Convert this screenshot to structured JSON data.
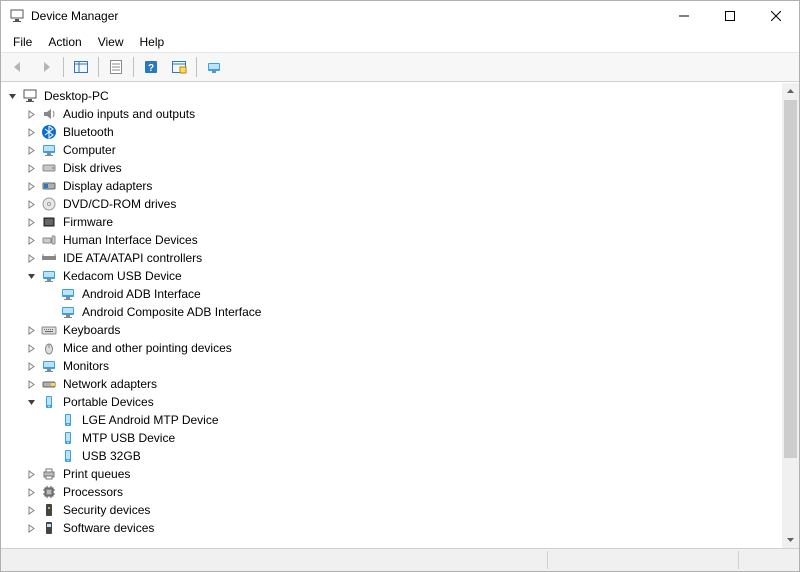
{
  "window": {
    "title": "Device Manager"
  },
  "menu": {
    "file": "File",
    "action": "Action",
    "view": "View",
    "help": "Help"
  },
  "tree": {
    "root": "Desktop-PC",
    "items": [
      {
        "icon": "audio",
        "label": "Audio inputs and outputs",
        "expand": "closed"
      },
      {
        "icon": "bluetooth",
        "label": "Bluetooth",
        "expand": "closed"
      },
      {
        "icon": "computer",
        "label": "Computer",
        "expand": "closed"
      },
      {
        "icon": "disk",
        "label": "Disk drives",
        "expand": "closed"
      },
      {
        "icon": "display",
        "label": "Display adapters",
        "expand": "closed"
      },
      {
        "icon": "dvd",
        "label": "DVD/CD-ROM drives",
        "expand": "closed"
      },
      {
        "icon": "firmware",
        "label": "Firmware",
        "expand": "closed"
      },
      {
        "icon": "hid",
        "label": "Human Interface Devices",
        "expand": "closed"
      },
      {
        "icon": "ide",
        "label": "IDE ATA/ATAPI controllers",
        "expand": "closed"
      },
      {
        "icon": "monitor",
        "label": "Kedacom USB Device",
        "expand": "open",
        "children": [
          {
            "icon": "monitor",
            "label": "Android ADB Interface"
          },
          {
            "icon": "monitor",
            "label": "Android Composite ADB Interface"
          }
        ]
      },
      {
        "icon": "keyboard",
        "label": "Keyboards",
        "expand": "closed"
      },
      {
        "icon": "mouse",
        "label": "Mice and other pointing devices",
        "expand": "closed"
      },
      {
        "icon": "monitor",
        "label": "Monitors",
        "expand": "closed"
      },
      {
        "icon": "network",
        "label": "Network adapters",
        "expand": "closed"
      },
      {
        "icon": "portable",
        "label": "Portable Devices",
        "expand": "open",
        "children": [
          {
            "icon": "portable",
            "label": "LGE Android MTP Device"
          },
          {
            "icon": "portable",
            "label": "MTP USB Device"
          },
          {
            "icon": "portable",
            "label": "USB 32GB"
          }
        ]
      },
      {
        "icon": "printer",
        "label": "Print queues",
        "expand": "closed"
      },
      {
        "icon": "processor",
        "label": "Processors",
        "expand": "closed"
      },
      {
        "icon": "security",
        "label": "Security devices",
        "expand": "closed"
      },
      {
        "icon": "software",
        "label": "Software devices",
        "expand": "closed"
      }
    ]
  }
}
